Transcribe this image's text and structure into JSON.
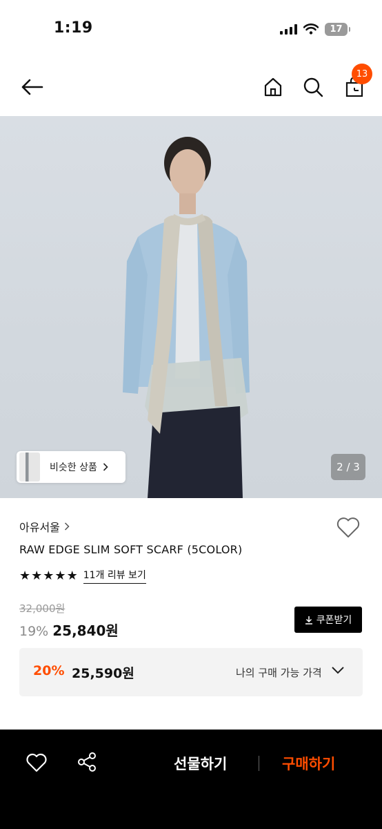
{
  "status_bar": {
    "time": "1:19",
    "battery": "17"
  },
  "nav": {
    "cart_count": "13"
  },
  "image": {
    "similar_label": "비슷한 상품",
    "page_indicator": "2 / 3"
  },
  "product": {
    "brand": "아유서울",
    "title": "RAW EDGE SLIM SOFT SCARF (5COLOR)",
    "rating": 5,
    "review_link": "11개 리뷰 보기",
    "original_price": "32,000원",
    "discount": "19%",
    "sale_price": "25,840원",
    "coupon_label": "쿠폰받기"
  },
  "my_price": {
    "discount": "20%",
    "price": "25,590원",
    "label": "나의 구매 가능 가격"
  },
  "bottom_bar": {
    "gift_label": "선물하기",
    "buy_label": "구매하기"
  },
  "colors": {
    "accent": "#ff4d00",
    "bottom_bar": "#000000",
    "price_box": "#f3f3f3"
  },
  "icons": [
    "back-arrow-icon",
    "home-icon",
    "search-icon",
    "cart-icon",
    "heart-icon",
    "share-icon",
    "star-icon",
    "download-icon",
    "chevron-down-icon",
    "chevron-right-icon"
  ]
}
